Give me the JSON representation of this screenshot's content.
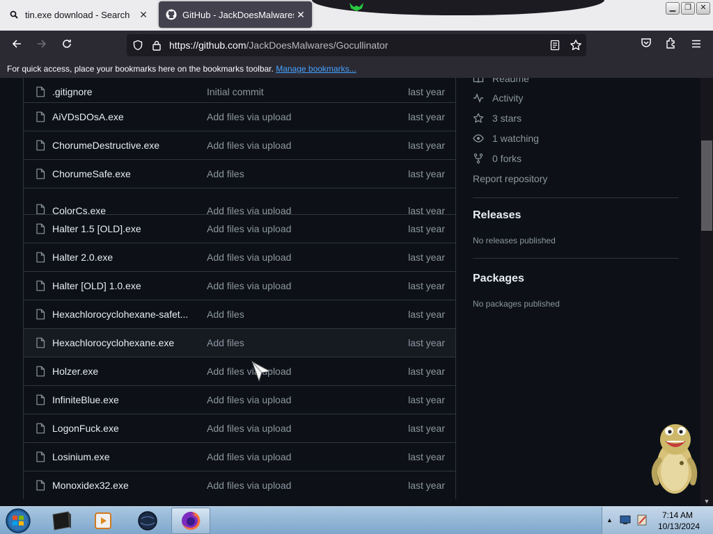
{
  "browser": {
    "tabs": [
      {
        "title": "tin.exe download - Search",
        "icon": "search-icon"
      },
      {
        "title": "GitHub - JackDoesMalwares/Go",
        "icon": "github-icon"
      }
    ],
    "url_host": "https://github.com",
    "url_path": "/JackDoesMalwares/Gocullinator",
    "bookmarks_bar_text": "For quick access, place your bookmarks here on the bookmarks toolbar.",
    "bookmarks_link": "Manage bookmarks..."
  },
  "files": [
    {
      "name": ".gitignore",
      "message": "Initial commit",
      "date": "last year"
    },
    {
      "name": "AiVDsDOsA.exe",
      "message": "Add files via upload",
      "date": "last year"
    },
    {
      "name": "ChorumeDestructive.exe",
      "message": "Add files via upload",
      "date": "last year"
    },
    {
      "name": "ChorumeSafe.exe",
      "message": "Add files",
      "date": "last year"
    },
    {
      "name": "ColorCs.exe",
      "message": "Add files via upload",
      "date": "last year"
    },
    {
      "name": "Halter 1.5 [OLD].exe",
      "message": "Add files via upload",
      "date": "last year"
    },
    {
      "name": "Halter 2.0.exe",
      "message": "Add files via upload",
      "date": "last year"
    },
    {
      "name": "Halter [OLD] 1.0.exe",
      "message": "Add files via upload",
      "date": "last year"
    },
    {
      "name": "Hexachlorocyclohexane-safet...",
      "message": "Add files",
      "date": "last year"
    },
    {
      "name": "Hexachlorocyclohexane.exe",
      "message": "Add files",
      "date": "last year"
    },
    {
      "name": "Holzer.exe",
      "message": "Add files via upload",
      "date": "last year"
    },
    {
      "name": "InfiniteBlue.exe",
      "message": "Add files via upload",
      "date": "last year"
    },
    {
      "name": "LogonFuck.exe",
      "message": "Add files via upload",
      "date": "last year"
    },
    {
      "name": "Losinium.exe",
      "message": "Add files via upload",
      "date": "last year"
    },
    {
      "name": "Monoxidex32.exe",
      "message": "Add files via upload",
      "date": "last year"
    }
  ],
  "sidebar": {
    "readme": "Readme",
    "activity": "Activity",
    "stars": "3 stars",
    "watching": "1 watching",
    "forks": "0 forks",
    "report": "Report repository",
    "releases_heading": "Releases",
    "releases_text": "No releases published",
    "packages_heading": "Packages",
    "packages_text": "No packages published"
  },
  "taskbar": {
    "time": "7:14 AM",
    "date": "10/13/2024"
  },
  "colors": {
    "page_bg": "#0d1117",
    "border": "#30363d",
    "text_primary": "#e6edf3",
    "text_muted": "#8d96a0",
    "link": "#45a1ff"
  }
}
